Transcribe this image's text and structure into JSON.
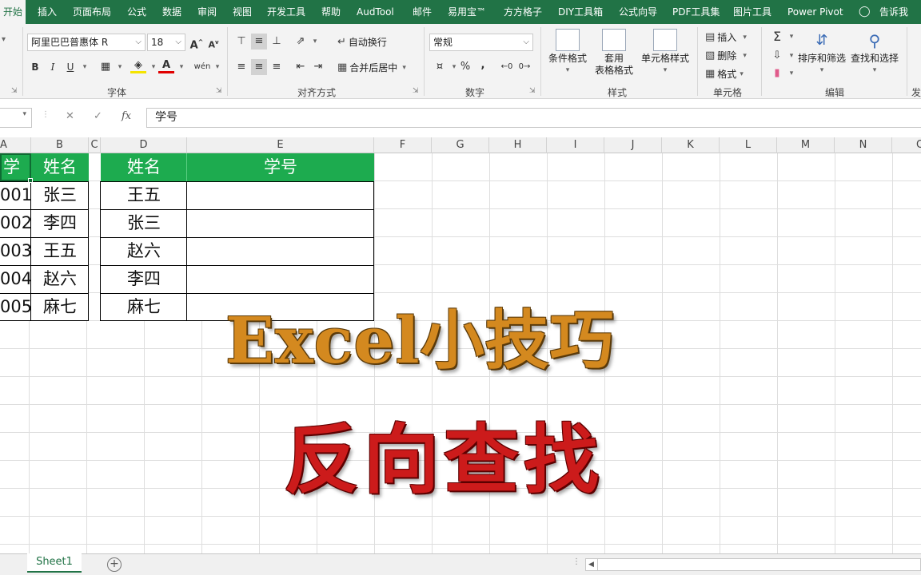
{
  "tabs": [
    "开始",
    "插入",
    "页面布局",
    "公式",
    "数据",
    "审阅",
    "视图",
    "开发工具",
    "帮助",
    "AudTool",
    "邮件",
    "易用宝™",
    "方方格子",
    "DIY工具箱",
    "公式向导",
    "PDF工具集",
    "图片工具",
    "Power Pivot",
    "告诉我"
  ],
  "ribbon": {
    "font_name": "阿里巴巴普惠体 R",
    "font_size": "18",
    "grow_font": "A",
    "shrink_font": "A",
    "bold": "B",
    "italic": "I",
    "underline": "U",
    "font_color_letter": "A",
    "phonetic": "wén",
    "wrap_text": "自动换行",
    "merge_center": "合并后居中",
    "number_format": "常规",
    "percent": "%",
    "comma": ",",
    "cond_format": "条件格式",
    "format_table_1": "套用",
    "format_table_2": "表格格式",
    "cell_styles": "单元格样式",
    "insert": "插入",
    "delete": "删除",
    "format": "格式",
    "sort_filter": "排序和筛选",
    "find_select": "查找和选择",
    "groups": {
      "font": "字体",
      "alignment": "对齐方式",
      "number": "数字",
      "styles": "样式",
      "cells": "单元格",
      "editing": "编辑",
      "cut_off": "发"
    }
  },
  "formula_bar": {
    "fx": "fx",
    "value": "学号"
  },
  "columns": [
    "A",
    "B",
    "C",
    "D",
    "E",
    "F",
    "G",
    "H",
    "I",
    "J",
    "K",
    "L",
    "M",
    "N",
    "O"
  ],
  "table1": {
    "headers": [
      "学号",
      "姓名"
    ],
    "rows": [
      [
        "001",
        "张三"
      ],
      [
        "002",
        "李四"
      ],
      [
        "003",
        "王五"
      ],
      [
        "004",
        "赵六"
      ],
      [
        "005",
        "麻七"
      ]
    ]
  },
  "table2": {
    "headers": [
      "姓名",
      "学号"
    ],
    "rows": [
      [
        "王五",
        ""
      ],
      [
        "张三",
        ""
      ],
      [
        "赵六",
        ""
      ],
      [
        "李四",
        ""
      ],
      [
        "麻七",
        ""
      ]
    ]
  },
  "overlay": {
    "line1": "Excel小技巧",
    "line2": "反向查找"
  },
  "sheet": {
    "tab": "Sheet1",
    "add": "+"
  }
}
